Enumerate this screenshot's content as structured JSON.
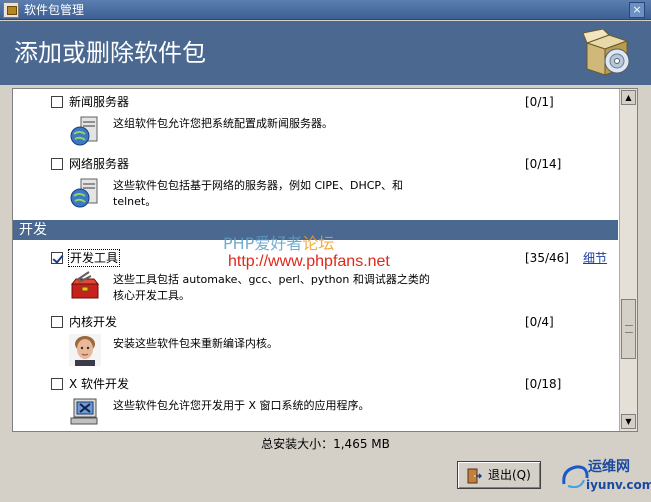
{
  "window": {
    "title": "软件包管理"
  },
  "header": {
    "title": "添加或删除软件包"
  },
  "groups_top": [
    {
      "label": "新闻服务器",
      "count": "[0/1]",
      "checked": false,
      "description": "这组软件包允许您把系统配置成新闻服务器。"
    },
    {
      "label": "网络服务器",
      "count": "[0/14]",
      "checked": false,
      "description_1": "这些软件包包括基于网络的服务器，例如 CIPE、DHCP、和",
      "description_2": "telnet。"
    }
  ],
  "section": {
    "title": "开发"
  },
  "groups_dev": [
    {
      "label": "开发工具",
      "count": "[35/46]",
      "checked": true,
      "details_label": "细节",
      "description_1": "这些工具包括 automake、gcc、perl、python 和调试器之类的",
      "description_2": "核心开发工具。"
    },
    {
      "label": "内核开发",
      "count": "[0/4]",
      "checked": false,
      "description": "安装这些软件包来重新编译内核。"
    },
    {
      "label": "X 软件开发",
      "count": "[0/18]",
      "checked": false,
      "description": "这些软件包允许您开发用于 X 窗口系统的应用程序。"
    }
  ],
  "watermark": {
    "top_a": "PHP爱好者",
    "top_b": "论坛",
    "url": "http://www.phpfans.net"
  },
  "footer": {
    "total_size": "总安装大小：1,465 MB",
    "quit_label": "退出(Q)"
  },
  "logo": {
    "name": "运维网",
    "domain": "iyunv.com"
  },
  "colors": {
    "header_bg": "#4a6890",
    "section_bg": "#4a6890",
    "link": "#1a3ea0"
  }
}
